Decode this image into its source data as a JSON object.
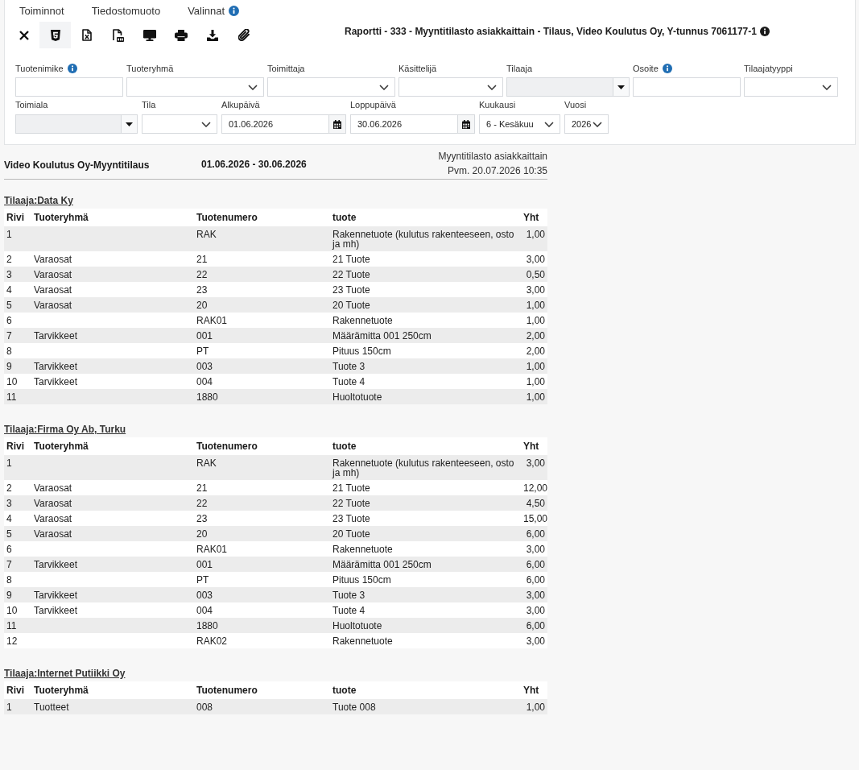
{
  "menu": [
    {
      "label": "Toiminnot",
      "info": false
    },
    {
      "label": "Tiedostomuoto",
      "info": false
    },
    {
      "label": "Valinnat",
      "info": true
    }
  ],
  "toolbar": [
    {
      "kind": "close",
      "selected": false
    },
    {
      "kind": "html",
      "selected": true
    },
    {
      "kind": "excel",
      "selected": false
    },
    {
      "kind": "pdf",
      "selected": false
    },
    {
      "kind": "screen",
      "selected": false
    },
    {
      "kind": "print",
      "selected": false
    },
    {
      "kind": "download",
      "selected": false
    },
    {
      "kind": "attach",
      "selected": false
    }
  ],
  "report_title": {
    "text": "Raportti - 333 - Myyntitilasto asiakkaittain - Tilaus, Video Koulutus Oy, Y-tunnus 7061177-1",
    "info": true
  },
  "filters": [
    [
      {
        "label": "Tuotenimike",
        "info": true,
        "kind": "text",
        "disabled": false
      },
      {
        "label": "Tuoteryhmä",
        "info": false,
        "kind": "select",
        "disabled": false
      },
      {
        "label": "Toimittaja",
        "info": false,
        "kind": "select",
        "disabled": false
      },
      {
        "label": "Käsittelijä",
        "info": false,
        "kind": "select",
        "disabled": false
      },
      {
        "label": "Tilaaja",
        "info": false,
        "kind": "combo",
        "disabled": true
      },
      {
        "label": "Osoite",
        "info": true,
        "kind": "text",
        "disabled": false
      },
      {
        "label": "Tilaajatyyppi",
        "info": false,
        "kind": "select",
        "disabled": false
      }
    ],
    [
      {
        "label": "Toimiala",
        "info": false,
        "kind": "combo",
        "disabled": true
      },
      {
        "label": "Tila",
        "info": false,
        "kind": "select",
        "disabled": false
      },
      {
        "label": "Alkupäivä",
        "info": false,
        "kind": "date",
        "disabled": false,
        "value": "01.06.2026"
      },
      {
        "label": "Loppupäivä",
        "info": false,
        "kind": "date",
        "disabled": false,
        "value": "30.06.2026"
      },
      {
        "label": "Kuukausi",
        "info": false,
        "kind": "select",
        "disabled": false,
        "value": "6 - Kesäkuu"
      },
      {
        "label": "Vuosi",
        "info": false,
        "kind": "select",
        "disabled": false,
        "value": "2026"
      }
    ]
  ],
  "report": {
    "company": "Video Koulutus Oy-Myyntitilaus",
    "period": "01.06.2026 - 30.06.2026",
    "report_name": "Myyntitilasto asiakkaittain",
    "printed": "Pvm. 20.07.2026 10:35"
  },
  "groups": [
    {
      "title": "Tilaaja:Data Ky",
      "columns": [
        "Rivi",
        "Tuoteryhmä",
        "Tuotenumero",
        "tuote",
        "Yht"
      ],
      "rows": [
        {
          "rivi": "1",
          "tuotenumero": "RAK",
          "tuote": "Rakennetuote (kulutus rakenteeseen, osto ja mh)",
          "yht": "1,00"
        },
        {
          "rivi": "2",
          "tuoteryhma": "Varaosat",
          "tuotenumero": "21",
          "tuote": "21 Tuote",
          "yht": "3,00"
        },
        {
          "rivi": "3",
          "tuoteryhma": "Varaosat",
          "tuotenumero": "22",
          "tuote": "22 Tuote",
          "yht": "0,50"
        },
        {
          "rivi": "4",
          "tuoteryhma": "Varaosat",
          "tuotenumero": "23",
          "tuote": "23 Tuote",
          "yht": "3,00"
        },
        {
          "rivi": "5",
          "tuoteryhma": "Varaosat",
          "tuotenumero": "20",
          "tuote": "20 Tuote",
          "yht": "1,00"
        },
        {
          "rivi": "6",
          "tuotenumero": "RAK01",
          "tuote": "Rakennetuote",
          "yht": "1,00"
        },
        {
          "rivi": "7",
          "tuoteryhma": "Tarvikkeet",
          "tuotenumero": "001",
          "tuote": "Määrämitta 001 250cm",
          "yht": "2,00"
        },
        {
          "rivi": "8",
          "tuotenumero": "PT",
          "tuote": "Pituus 150cm",
          "yht": "2,00"
        },
        {
          "rivi": "9",
          "tuoteryhma": "Tarvikkeet",
          "tuotenumero": "003",
          "tuote": "Tuote 3",
          "yht": "1,00"
        },
        {
          "rivi": "10",
          "tuoteryhma": "Tarvikkeet",
          "tuotenumero": "004",
          "tuote": "Tuote 4",
          "yht": "1,00"
        },
        {
          "rivi": "11",
          "tuotenumero": "1880",
          "tuote": "Huoltotuote",
          "yht": "1,00"
        }
      ]
    },
    {
      "title": "Tilaaja:Firma Oy Ab, Turku",
      "columns": [
        "Rivi",
        "Tuoteryhmä",
        "Tuotenumero",
        "tuote",
        "Yht"
      ],
      "rows": [
        {
          "rivi": "1",
          "tuotenumero": "RAK",
          "tuote": "Rakennetuote (kulutus rakenteeseen, osto ja mh)",
          "yht": "3,00"
        },
        {
          "rivi": "2",
          "tuoteryhma": "Varaosat",
          "tuotenumero": "21",
          "tuote": "21 Tuote",
          "yht": "12,00"
        },
        {
          "rivi": "3",
          "tuoteryhma": "Varaosat",
          "tuotenumero": "22",
          "tuote": "22 Tuote",
          "yht": "4,50"
        },
        {
          "rivi": "4",
          "tuoteryhma": "Varaosat",
          "tuotenumero": "23",
          "tuote": "23 Tuote",
          "yht": "15,00"
        },
        {
          "rivi": "5",
          "tuoteryhma": "Varaosat",
          "tuotenumero": "20",
          "tuote": "20 Tuote",
          "yht": "6,00"
        },
        {
          "rivi": "6",
          "tuotenumero": "RAK01",
          "tuote": "Rakennetuote",
          "yht": "3,00"
        },
        {
          "rivi": "7",
          "tuoteryhma": "Tarvikkeet",
          "tuotenumero": "001",
          "tuote": "Määrämitta 001 250cm",
          "yht": "6,00"
        },
        {
          "rivi": "8",
          "tuotenumero": "PT",
          "tuote": "Pituus 150cm",
          "yht": "6,00"
        },
        {
          "rivi": "9",
          "tuoteryhma": "Tarvikkeet",
          "tuotenumero": "003",
          "tuote": "Tuote 3",
          "yht": "3,00"
        },
        {
          "rivi": "10",
          "tuoteryhma": "Tarvikkeet",
          "tuotenumero": "004",
          "tuote": "Tuote 4",
          "yht": "3,00"
        },
        {
          "rivi": "11",
          "tuotenumero": "1880",
          "tuote": "Huoltotuote",
          "yht": "6,00"
        },
        {
          "rivi": "12",
          "tuotenumero": "RAK02",
          "tuote": "Rakennetuote",
          "yht": "3,00"
        }
      ]
    },
    {
      "title": "Tilaaja:Internet Putiikki Oy",
      "columns": [
        "Rivi",
        "Tuoteryhmä",
        "Tuotenumero",
        "tuote",
        "Yht"
      ],
      "rows": [
        {
          "rivi": "1",
          "tuoteryhma": "Tuotteet",
          "tuotenumero": "008",
          "tuote": "Tuote 008",
          "yht": "1,00"
        }
      ]
    }
  ]
}
